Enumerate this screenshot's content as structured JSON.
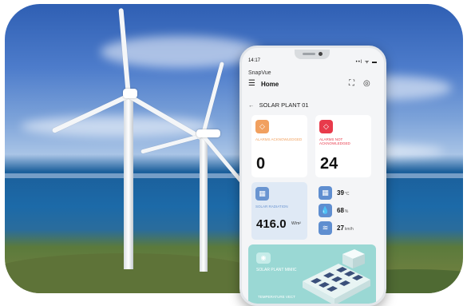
{
  "phone": {
    "status_time": "14:17",
    "status_icons": "••l ᯤ ▬",
    "app_name": "SnapVue",
    "nav_title": "Home",
    "breadcrumb": "SOLAR PLANT 01"
  },
  "alarms": {
    "acknowledged_label": "ALARMS ACKNOWLEDGED",
    "acknowledged_value": "0",
    "not_acknowledged_label": "ALARMS NOT ACKNOWLEDGED",
    "not_acknowledged_value": "24"
  },
  "radiation": {
    "label": "SOLAR RADIATION",
    "value": "416.0",
    "unit": "W/m²"
  },
  "metrics": [
    {
      "value": "39",
      "unit": "°C",
      "icon": "panel-temperature-icon"
    },
    {
      "value": "68",
      "unit": "%",
      "icon": "humidity-drop-icon"
    },
    {
      "value": "27",
      "unit": "km/h",
      "icon": "wind-icon"
    }
  ],
  "plant_card": {
    "label": "SOLAR PLANT MIMIC",
    "footer": "TEMPERATURE VECT"
  },
  "colors": {
    "orange": "#f1a05f",
    "red": "#e83a4b",
    "blue": "#6a95d1",
    "teal": "#9ad8d4"
  }
}
